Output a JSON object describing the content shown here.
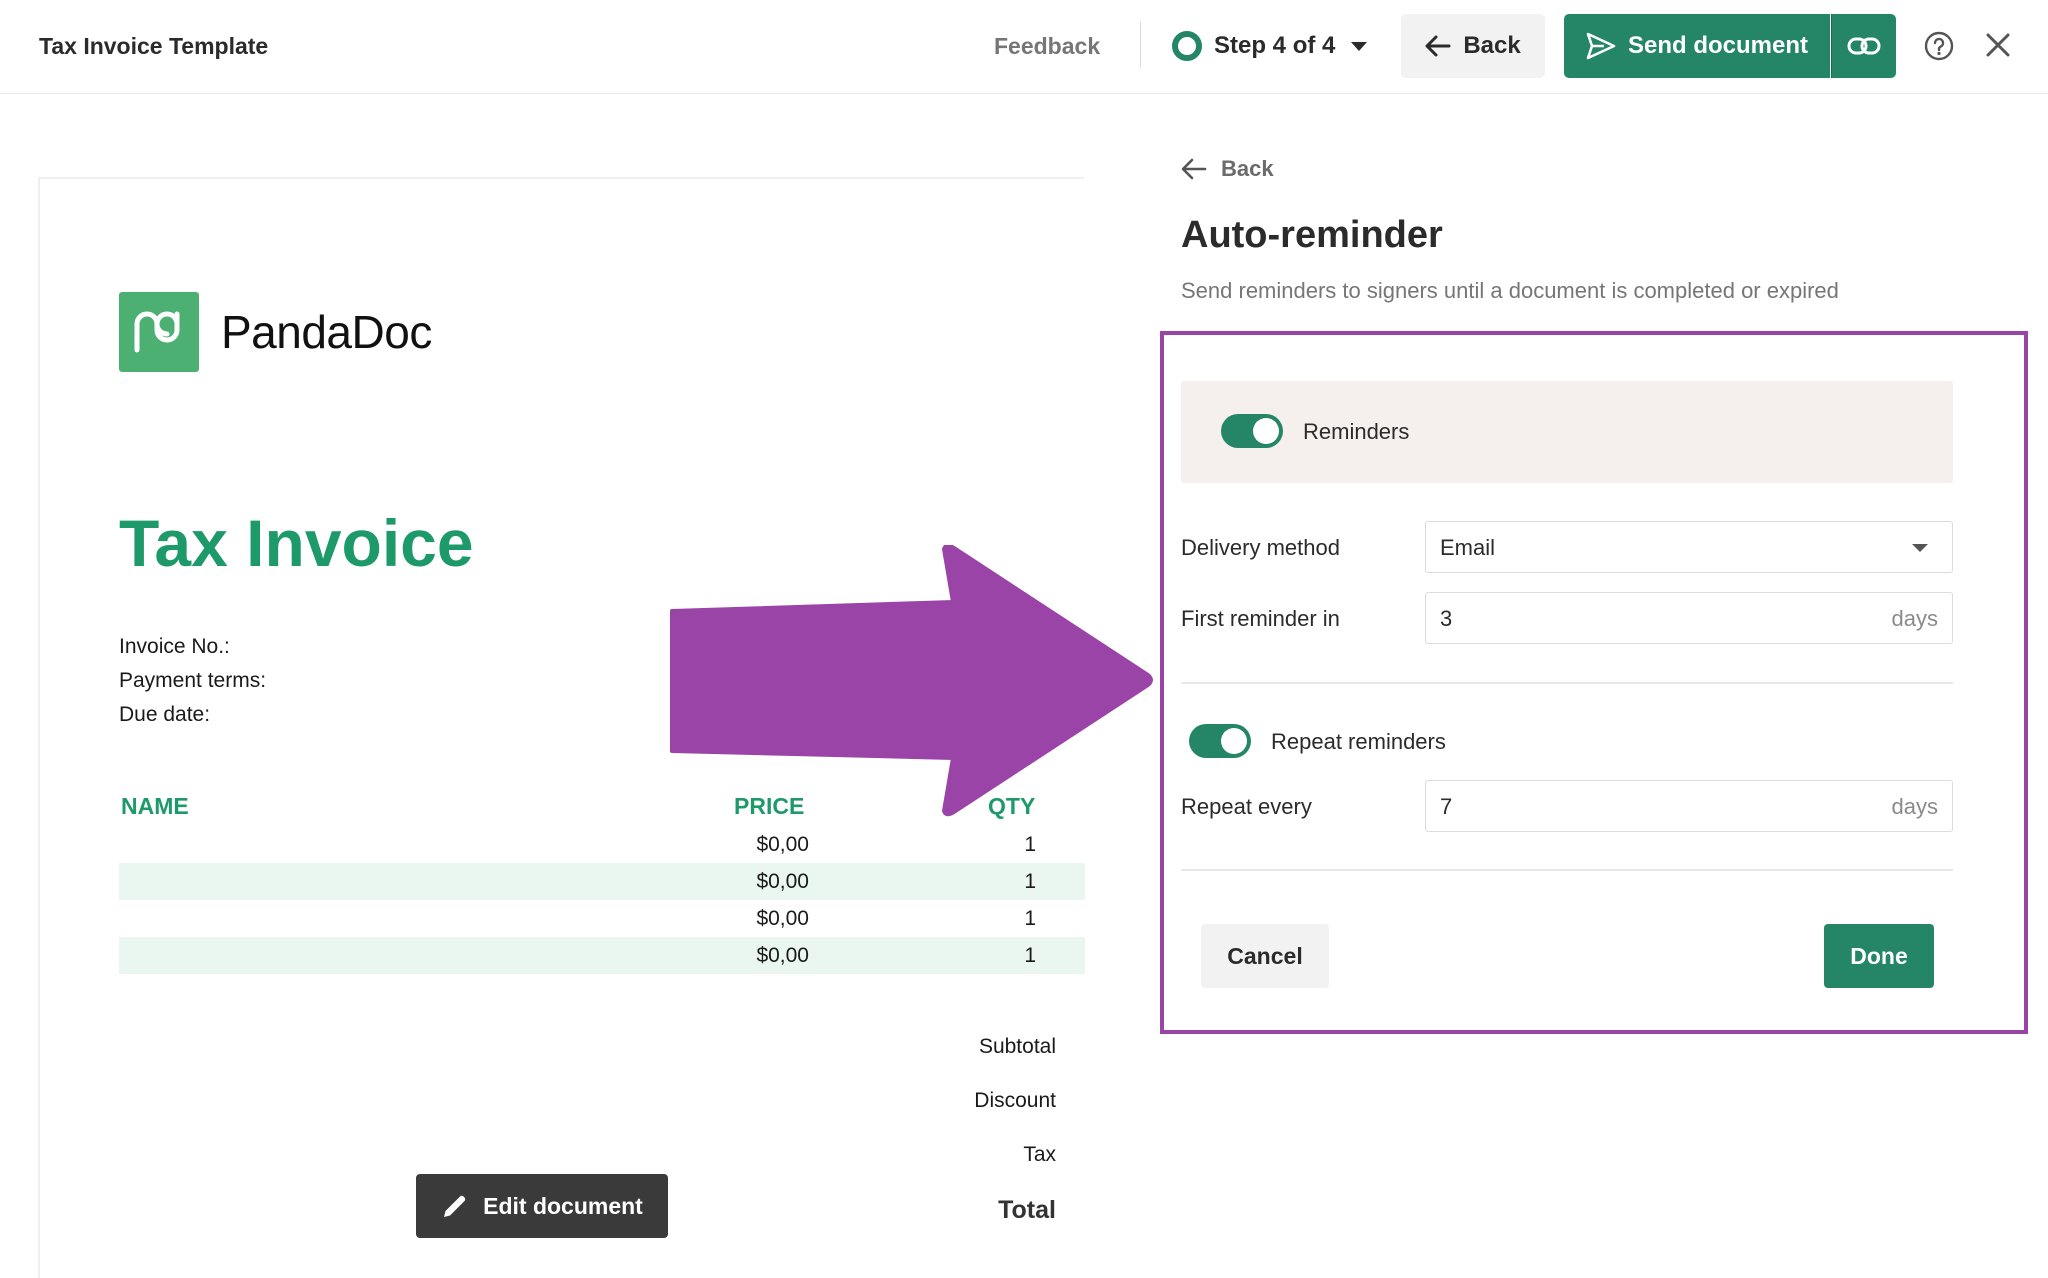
{
  "colors": {
    "accent": "#248567",
    "doc_green": "#1e9a6a",
    "annotation": "#9b44a8"
  },
  "topbar": {
    "title": "Tax Invoice Template",
    "feedback": "Feedback",
    "step": "Step 4 of 4",
    "back": "Back",
    "send": "Send document",
    "icons": [
      "circle-icon",
      "chevron-down-icon",
      "arrow-left-icon",
      "send-icon",
      "link-icon",
      "help-icon",
      "close-icon"
    ]
  },
  "document": {
    "logo_text": "PandaDoc",
    "title": "Tax Invoice",
    "meta": [
      "Invoice No.:",
      "Payment terms:",
      "Due date:"
    ],
    "columns": {
      "name": "NAME",
      "price": "PRICE",
      "qty": "QTY"
    },
    "rows": [
      {
        "price": "$0,00",
        "qty": "1"
      },
      {
        "price": "$0,00",
        "qty": "1"
      },
      {
        "price": "$0,00",
        "qty": "1"
      },
      {
        "price": "$0,00",
        "qty": "1"
      }
    ],
    "summary": {
      "subtotal": "Subtotal",
      "discount": "Discount",
      "tax": "Tax",
      "total": "Total"
    },
    "edit_button": "Edit document"
  },
  "panel": {
    "back": "Back",
    "title": "Auto-reminder",
    "subtitle": "Send reminders to signers until a document is completed or expired",
    "reminders_label": "Reminders",
    "reminders_on": true,
    "delivery_label": "Delivery method",
    "delivery_value": "Email",
    "first_label": "First reminder in",
    "first_value": "3",
    "unit": "days",
    "repeat_label": "Repeat reminders",
    "repeat_on": true,
    "repeat_every_label": "Repeat every",
    "repeat_every_value": "7",
    "cancel": "Cancel",
    "done": "Done"
  }
}
